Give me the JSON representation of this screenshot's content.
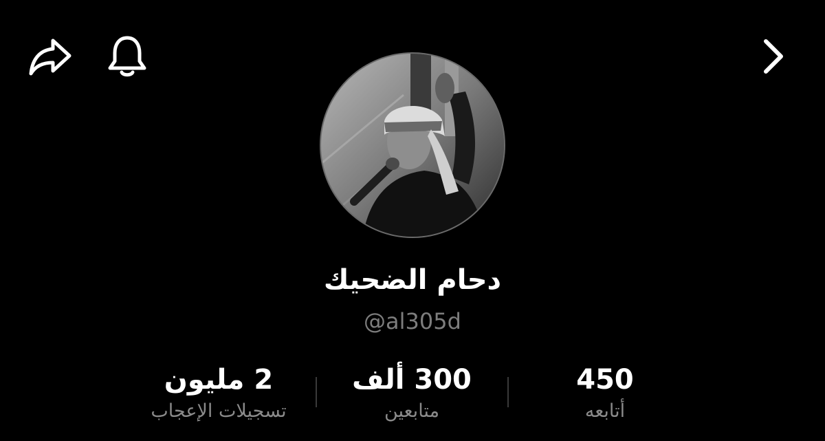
{
  "profile": {
    "display_name": "دحام الضحيك",
    "username": "@al305d"
  },
  "stats": {
    "following": {
      "value": "450",
      "label": "أتابعه"
    },
    "followers": {
      "value": "300 ألف",
      "label": "متابعين"
    },
    "likes": {
      "value": "2 مليون",
      "label": "تسجيلات الإعجاب"
    }
  },
  "icons": {
    "share": "share-arrow-icon",
    "notifications": "bell-icon",
    "forward": "chevron-right-icon"
  },
  "colors": {
    "background": "#000000",
    "primary_text": "#ffffff",
    "secondary_text": "#7d7d7d"
  }
}
